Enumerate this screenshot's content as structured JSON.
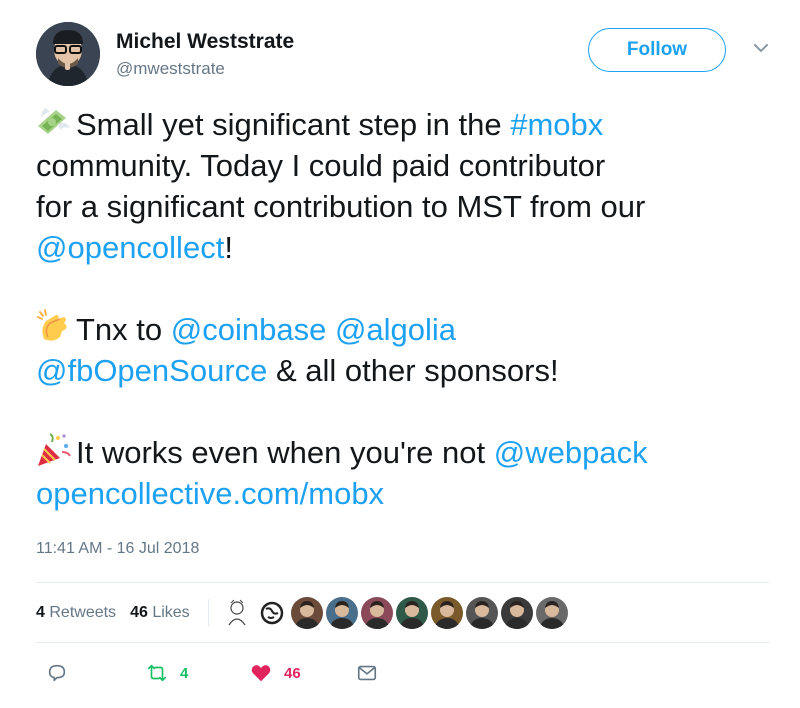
{
  "author": {
    "name": "Michel Weststrate",
    "handle": "@mweststrate"
  },
  "header": {
    "follow_label": "Follow"
  },
  "tweet": {
    "lines": [
      [
        {
          "t": "Small yet significant step in the "
        },
        {
          "t": "#mobx",
          "link": true
        }
      ],
      [
        {
          "t": "community. Today I could paid  contributor"
        }
      ],
      [
        {
          "t": "for a significant contribution to MST from our"
        }
      ],
      [
        {
          "t": "@opencollect",
          "link": true
        },
        {
          "t": "!"
        }
      ],
      [
        {
          "t": "Tnx to "
        },
        {
          "t": "@coinbase",
          "link": true
        },
        {
          "t": " "
        },
        {
          "t": "@algolia",
          "link": true
        }
      ],
      [
        {
          "t": "@fbOpenSource",
          "link": true
        },
        {
          "t": " & all other sponsors!"
        }
      ],
      [
        {
          "t": "It works even when you're not "
        },
        {
          "t": "@webpack",
          "link": true
        }
      ],
      [
        {
          "t": "opencollective.com/mobx",
          "link": true
        }
      ]
    ],
    "emojis": [
      "money-with-wings-icon",
      "clapping-hands-icon",
      "party-popper-icon"
    ],
    "timestamp": "11:41 AM - 16 Jul 2018"
  },
  "stats": {
    "retweets_count": "4",
    "retweets_label": "Retweets",
    "likes_count": "46",
    "likes_label": "Likes"
  },
  "likers": [
    {
      "icon": "sketch-avatar",
      "color": "#ffffff"
    },
    {
      "icon": "globe-avatar",
      "color": "#333333"
    },
    {
      "icon": "person-avatar",
      "color": "#6b4a3a"
    },
    {
      "icon": "person-avatar",
      "color": "#4a6f8a"
    },
    {
      "icon": "person-avatar",
      "color": "#8a4a5a"
    },
    {
      "icon": "person-avatar",
      "color": "#2f5a4a"
    },
    {
      "icon": "person-avatar",
      "color": "#7a5a2a"
    },
    {
      "icon": "person-avatar",
      "color": "#555555"
    },
    {
      "icon": "person-avatar",
      "color": "#3a3a3a"
    },
    {
      "icon": "person-avatar",
      "color": "#6a6a6a"
    }
  ],
  "actions": {
    "retweet_count": "4",
    "like_count": "46"
  },
  "colors": {
    "link": "#1da1f2",
    "retweet": "#17bf63",
    "like": "#e0245e",
    "muted": "#657786"
  }
}
